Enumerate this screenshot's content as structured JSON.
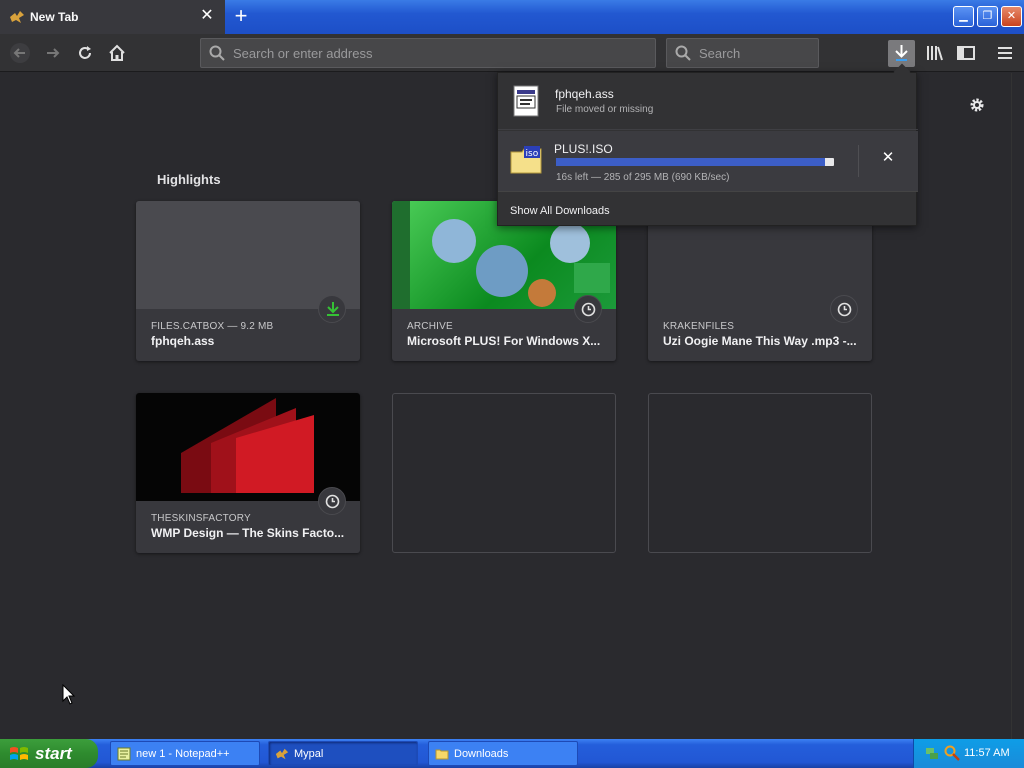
{
  "browser": {
    "tab": {
      "title": "New Tab"
    },
    "url_placeholder": "Search or enter address",
    "search_placeholder": "Search"
  },
  "highlights": {
    "title": "Highlights",
    "cards": [
      {
        "source": "FILES.CATBOX — 9.2 MB",
        "title": "fphqeh.ass",
        "badge": "download-icon"
      },
      {
        "source": "ARCHIVE",
        "title": "Microsoft PLUS! For Windows X...",
        "badge": "clock-icon"
      },
      {
        "source": "KRAKENFILES",
        "title": "Uzi Oogie Mane This Way .mp3 -...",
        "badge": "clock-icon"
      },
      {
        "source": "THESKINSFACTORY",
        "title": "WMP Design — The Skins Facto...",
        "badge": "clock-icon"
      }
    ]
  },
  "downloads": {
    "items": [
      {
        "name": "fphqeh.ass",
        "status": "File moved or missing"
      },
      {
        "name": "PLUS!.ISO",
        "status": "16s left — 285 of 295 MB (690 KB/sec)",
        "progress": 0.966
      }
    ],
    "show_all": "Show All Downloads"
  },
  "taskbar": {
    "start": "start",
    "tasks": [
      {
        "label": "new 1 - Notepad++"
      },
      {
        "label": "Mypal"
      },
      {
        "label": "Downloads"
      }
    ],
    "clock": "11:57 AM"
  },
  "colors": {
    "accent": "#3c5ec7",
    "download_green": "#35c235"
  }
}
